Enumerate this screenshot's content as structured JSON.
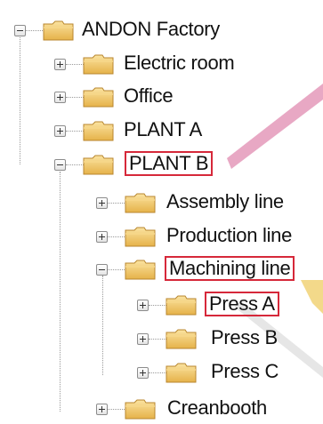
{
  "tree": {
    "nodes": [
      {
        "id": "andon",
        "label": "ANDON Factory",
        "expander": "minus",
        "highlighted": false
      },
      {
        "id": "electric",
        "label": "Electric room",
        "expander": "plus",
        "highlighted": false
      },
      {
        "id": "office",
        "label": "Office",
        "expander": "plus",
        "highlighted": false
      },
      {
        "id": "planta",
        "label": "PLANT A",
        "expander": "plus",
        "highlighted": false
      },
      {
        "id": "plantb",
        "label": "PLANT B",
        "expander": "minus",
        "highlighted": true
      },
      {
        "id": "assembly",
        "label": "Assembly line",
        "expander": "plus",
        "highlighted": false
      },
      {
        "id": "production",
        "label": "Production line",
        "expander": "plus",
        "highlighted": false
      },
      {
        "id": "machining",
        "label": "Machining line",
        "expander": "minus",
        "highlighted": true
      },
      {
        "id": "pressa",
        "label": "Press A",
        "expander": "plus",
        "highlighted": true
      },
      {
        "id": "pressb",
        "label": "Press B",
        "expander": "plus",
        "highlighted": false
      },
      {
        "id": "pressc",
        "label": "Press C",
        "expander": "plus",
        "highlighted": false
      },
      {
        "id": "creanbooth",
        "label": "Creanbooth",
        "expander": "plus",
        "highlighted": false
      }
    ]
  },
  "colors": {
    "highlight_box": "#d6283a",
    "callout_pink": "#e8a8c4",
    "callout_yellow": "#f3d98a",
    "connector_line": "#9a9a9a",
    "folder_fill": "#f2c867",
    "folder_edge": "#b8862e"
  },
  "icons": {
    "folder": "folder-icon",
    "expand": "plus-box-icon",
    "collapse": "minus-box-icon"
  }
}
